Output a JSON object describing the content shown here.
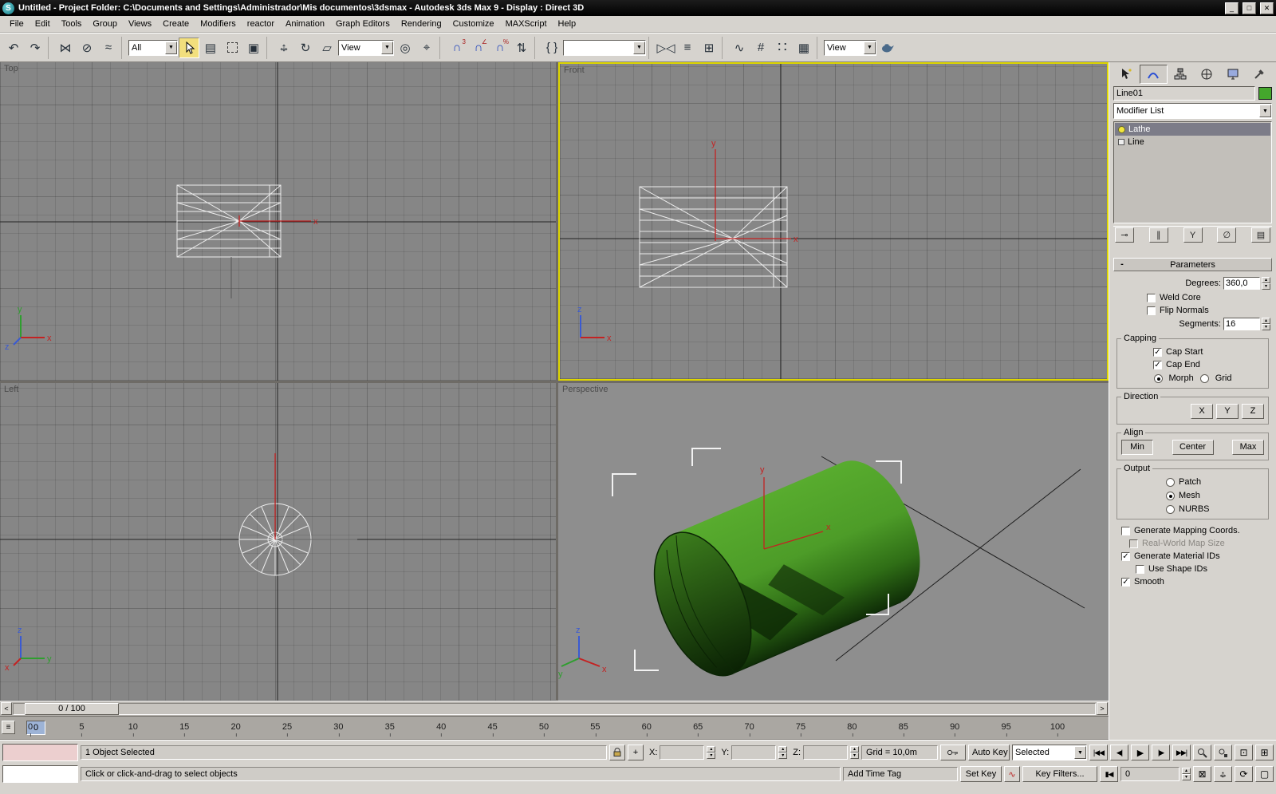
{
  "window": {
    "title": "Untitled     - Project Folder: C:\\Documents and Settings\\Administrador\\Mis documentos\\3dsmax     - Autodesk 3ds Max 9     - Display : Direct 3D"
  },
  "menu": {
    "items": [
      "File",
      "Edit",
      "Tools",
      "Group",
      "Views",
      "Create",
      "Modifiers",
      "reactor",
      "Animation",
      "Graph Editors",
      "Rendering",
      "Customize",
      "MAXScript",
      "Help"
    ]
  },
  "toolbar": {
    "selection_filter": "All",
    "coord_system": "View",
    "named_selection": "",
    "render_type": "View"
  },
  "axes": {
    "x": "x",
    "y": "y",
    "z": "z"
  },
  "viewports": {
    "top": "Top",
    "front": "Front",
    "left": "Left",
    "perspective": "Perspective"
  },
  "command_panel": {
    "object_name": "Line01",
    "object_color": "#44a72c",
    "modifier_list": "Modifier List",
    "stack": [
      {
        "label": "Lathe",
        "active": true,
        "bulb": true
      },
      {
        "label": "Line",
        "active": false,
        "bulb": false
      }
    ],
    "parameters": {
      "title": "Parameters",
      "degrees_label": "Degrees:",
      "degrees": "360,0",
      "weld_core": "Weld Core",
      "flip_normals": "Flip Normals",
      "segments_label": "Segments:",
      "segments": "16",
      "capping_title": "Capping",
      "cap_start": "Cap Start",
      "cap_end": "Cap End",
      "morph": "Morph",
      "grid": "Grid",
      "direction_title": "Direction",
      "dir_x": "X",
      "dir_y": "Y",
      "dir_z": "Z",
      "align_title": "Align",
      "align_min": "Min",
      "align_center": "Center",
      "align_max": "Max",
      "output_title": "Output",
      "patch": "Patch",
      "mesh": "Mesh",
      "nurbs": "NURBS",
      "gen_mapping": "Generate Mapping Coords.",
      "real_world": "Real-World Map Size",
      "gen_mat_ids": "Generate Material IDs",
      "use_shape_ids": "Use Shape IDs",
      "smooth": "Smooth"
    }
  },
  "timeline": {
    "slider": "0 / 100",
    "ticks": [
      "0",
      "5",
      "10",
      "15",
      "20",
      "25",
      "30",
      "35",
      "40",
      "45",
      "50",
      "55",
      "60",
      "65",
      "70",
      "75",
      "80",
      "85",
      "90",
      "95",
      "100"
    ],
    "current": "0"
  },
  "status": {
    "selection": "1 Object Selected",
    "x_label": "X:",
    "y_label": "Y:",
    "z_label": "Z:",
    "x_value": "",
    "y_value": "",
    "z_value": "",
    "grid": "Grid = 10,0m",
    "prompt": "Click or click-and-drag to select objects",
    "add_time_tag": "Add Time Tag",
    "auto_key": "Auto Key",
    "set_key": "Set Key",
    "key_filter_mode": "Selected",
    "key_filters": "Key Filters...",
    "frame": "0"
  }
}
